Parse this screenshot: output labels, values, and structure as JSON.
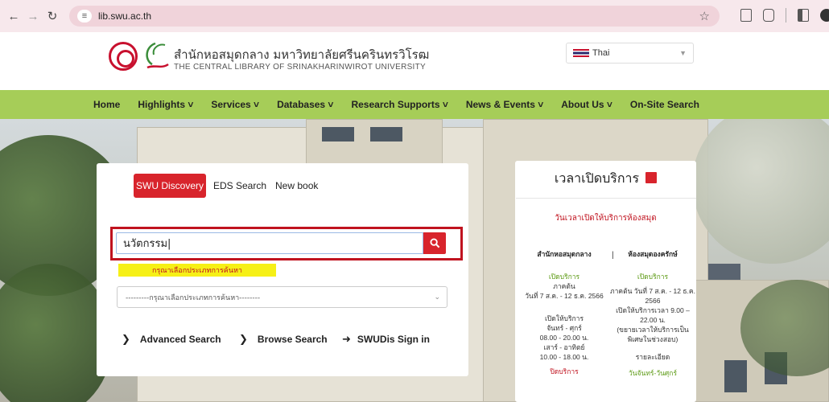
{
  "browser": {
    "url": "lib.swu.ac.th",
    "back_icon": "arrow-left-icon",
    "forward_icon": "arrow-right-icon",
    "reload_icon": "reload-icon"
  },
  "header": {
    "name_th": "สำนักหอสมุดกลาง มหาวิทยาลัยศรีนครินทรวิโรฒ",
    "name_en": "THE CENTRAL LIBRARY OF SRINAKHARINWIROT UNIVERSITY",
    "language": "Thai"
  },
  "nav": {
    "items": [
      "Home",
      "Highlights ˅",
      "Services ˅",
      "Databases ˅",
      "Research Supports ˅",
      "News & Events ˅",
      "About Us ˅",
      "On-Site Search"
    ]
  },
  "search": {
    "tabs": [
      "SWU Discovery",
      "EDS Search",
      "New book"
    ],
    "query": "นวัตกรรม|",
    "hint": "กรุณาเลือกประเภทการค้นหา",
    "type_placeholder": "---------กรุณาเลือกประเภทการค้นหา--------",
    "advanced": "Advanced Search",
    "browse": "Browse Search",
    "signin": "SWUDis Sign in"
  },
  "hours": {
    "title": "เวลาเปิดบริการ",
    "subtitle": "วันเวลาเปิดให้บริการห้องสมุด",
    "col1": {
      "heading": "สำนักหอสมุดกลาง",
      "open": "เปิดบริการ",
      "term": "ภาคต้น",
      "dates": "วันที่ 7 ส.ค. - 12 ธ.ค. 2566",
      "open2": "เปิดให้บริการ",
      "weekday": "จันทร์ - ศุกร์",
      "weekday_time": "08.00 - 20.00 น.",
      "weekend": "เสาร์ - อาทิตย์",
      "weekend_time": "10.00 - 18.00 น.",
      "closed": "ปิดบริการ"
    },
    "col2": {
      "heading": "ห้องสมุดองครักษ์",
      "open": "เปิดบริการ",
      "dates": "ภาคต้น วันที่ 7 ส.ค. - 12 ธ.ค. 2566",
      "note": "เปิดให้บริการเวลา 9.00 – 22.00 น.",
      "note2": "(ขยายเวลาให้บริการเป็นพิเศษในช่วงสอบ)",
      "detail": "รายละเอียด",
      "days": "วันจันทร์-วันศุกร์"
    }
  }
}
